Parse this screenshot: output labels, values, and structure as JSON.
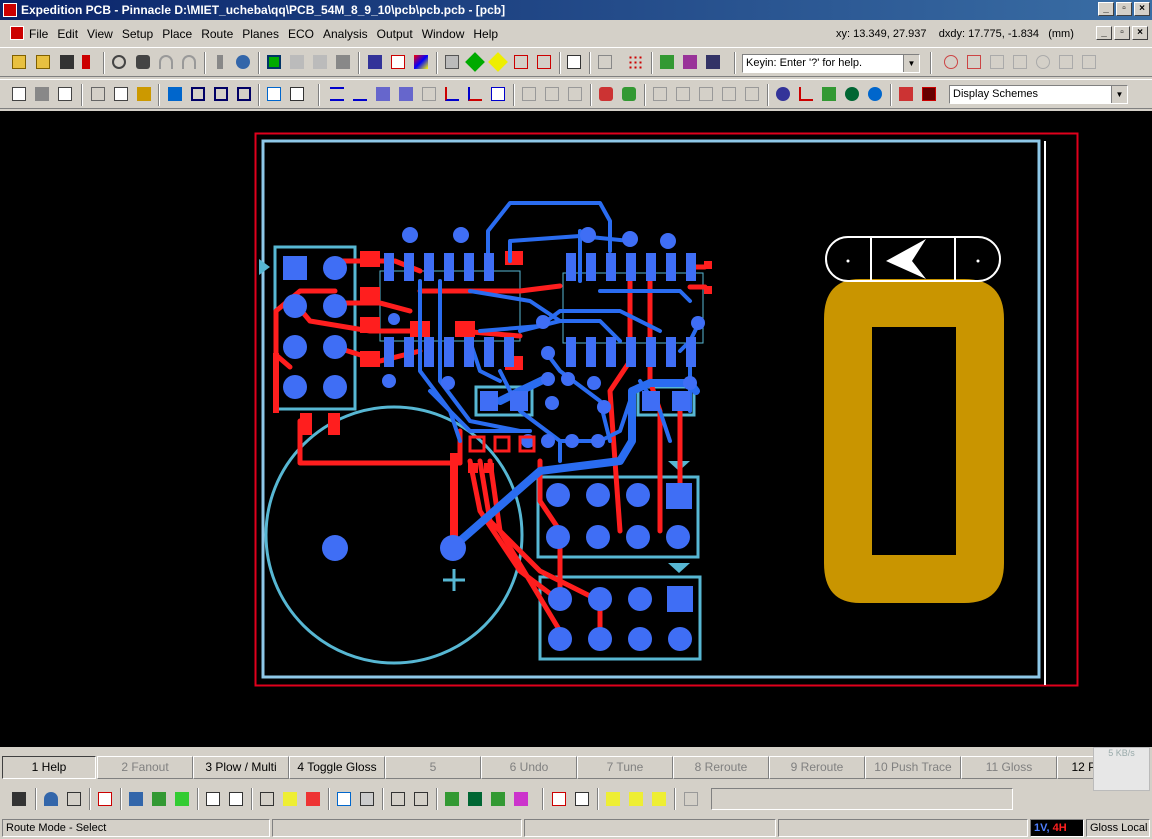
{
  "window": {
    "title": "Expedition PCB - Pinnacle  D:\\MIET_ucheba\\qq\\PCB_54M_8_9_10\\pcb\\pcb.pcb - [pcb]",
    "min": "_",
    "max": "▫",
    "close": "×"
  },
  "menu": {
    "items": [
      "File",
      "Edit",
      "View",
      "Setup",
      "Place",
      "Route",
      "Planes",
      "ECO",
      "Analysis",
      "Output",
      "Window",
      "Help"
    ]
  },
  "coords": {
    "xy": "xy: 13.349, 27.937",
    "dxdy": "dxdy: 17.775, -1.834",
    "unit": "(mm)"
  },
  "toolbar": {
    "keyin_placeholder": "Keyin: Enter '?' for help.",
    "display_schemes": "Display Schemes"
  },
  "fkeys": [
    {
      "label": "1 Help",
      "enabled": true
    },
    {
      "label": "2 Fanout",
      "enabled": false
    },
    {
      "label": "3 Plow / Multi",
      "enabled": true
    },
    {
      "label": "4 Toggle Gloss",
      "enabled": true
    },
    {
      "label": "5",
      "enabled": false
    },
    {
      "label": "6 Undo",
      "enabled": false
    },
    {
      "label": "7 Tune",
      "enabled": false
    },
    {
      "label": "8 Reroute",
      "enabled": false
    },
    {
      "label": "9 Reroute",
      "enabled": false
    },
    {
      "label": "10 Push Trace",
      "enabled": false
    },
    {
      "label": "11 Gloss",
      "enabled": false
    },
    {
      "label": "12 Place >>",
      "enabled": true
    }
  ],
  "status": {
    "mode": "Route Mode - Select",
    "layers_v": "1V,",
    "layers_h": "4H",
    "gloss": "Gloss Local"
  },
  "net_badge": "5 KB/s",
  "colors": {
    "board_outline": "#e0001c",
    "route_border": "#8ec8e8",
    "top_copper": "#ff1e1e",
    "bottom_copper": "#2a6cf0",
    "pads": "#3f6ef5",
    "silkscreen": "#57b7d3",
    "gold_pad": "#c99500",
    "canvas": "#000000"
  }
}
